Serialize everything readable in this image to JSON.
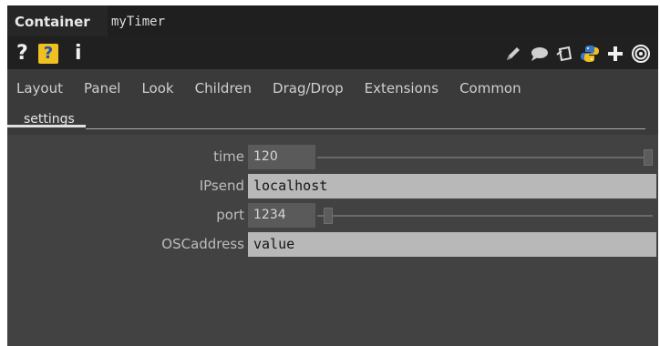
{
  "header": {
    "operator_type": "Container",
    "operator_name": "myTimer"
  },
  "toolbar": {
    "help_glyph": "?",
    "help_box_glyph": "?",
    "info_glyph": "i",
    "right_icons": [
      "pencil-icon",
      "comment-icon",
      "clone-icon",
      "python-icon",
      "plus-icon",
      "viewer-icon"
    ]
  },
  "tabs": [
    "Layout",
    "Panel",
    "Look",
    "Children",
    "Drag/Drop",
    "Extensions",
    "Common"
  ],
  "subtabs": [
    "settings"
  ],
  "params": {
    "time": {
      "label": "time",
      "value": "120",
      "slider_fraction": 1.0
    },
    "ipsend": {
      "label": "IPsend",
      "value": "localhost"
    },
    "port": {
      "label": "port",
      "value": "1234",
      "slider_fraction": 0.02
    },
    "oscaddress": {
      "label": "OSCaddress",
      "value": "value"
    }
  },
  "colors": {
    "panel_bg": "#424242",
    "titlebar_bg": "#262626",
    "accent_help": "#f0c020",
    "python_blue": "#3b76c4",
    "python_yellow": "#f0c020"
  }
}
